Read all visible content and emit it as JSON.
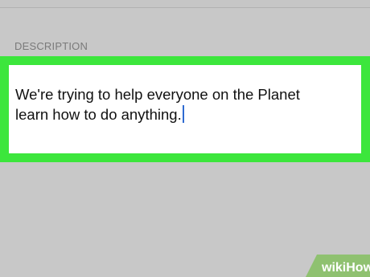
{
  "section": {
    "label": "DESCRIPTION"
  },
  "description_field": {
    "line1": "We're trying to help everyone on the Planet",
    "line2": "learn how to do anything."
  },
  "watermark": {
    "text": "wikiHow"
  },
  "colors": {
    "background": "#c8c8c8",
    "highlight": "#3ce63c",
    "caret": "#2f6bd1"
  }
}
